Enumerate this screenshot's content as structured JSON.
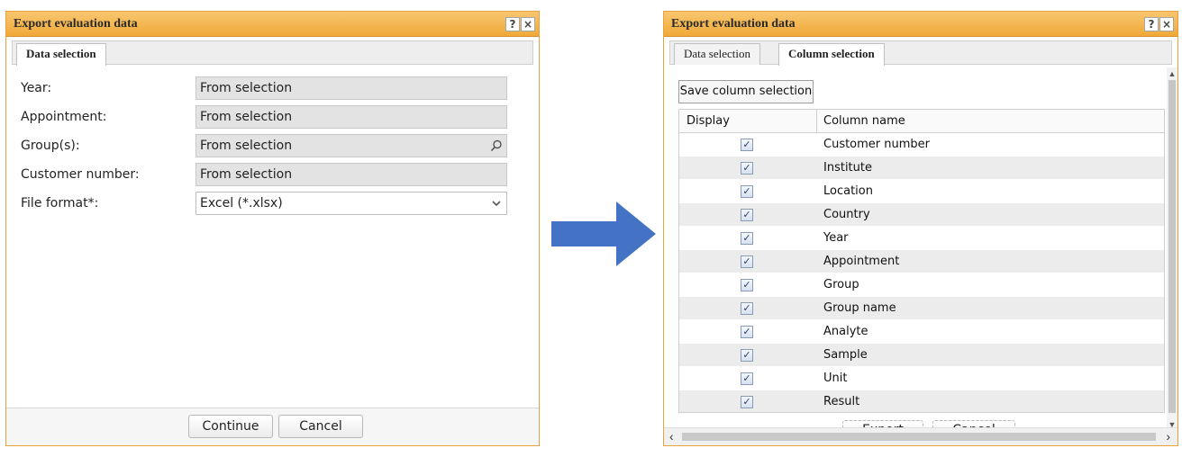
{
  "left_dialog": {
    "title": "Export evaluation data",
    "help_glyph": "?",
    "close_glyph": "×",
    "tabs": [
      {
        "label": "Data selection",
        "active": true
      }
    ],
    "fields": [
      {
        "label": "Year:",
        "value": "From selection"
      },
      {
        "label": "Appointment:",
        "value": "From selection"
      },
      {
        "label": "Group(s):",
        "value": "From selection",
        "icon": "search-icon"
      },
      {
        "label": "Customer number:",
        "value": "From selection"
      },
      {
        "label": "File format*:",
        "value": "Excel (*.xlsx)",
        "icon": "chevron-down-icon"
      }
    ],
    "continue_label": "Continue",
    "cancel_label": "Cancel"
  },
  "right_dialog": {
    "title": "Export evaluation data",
    "help_glyph": "?",
    "close_glyph": "×",
    "tabs": [
      {
        "label": "Data selection",
        "active": false
      },
      {
        "label": "Column selection",
        "active": true
      }
    ],
    "save_label": "Save column selection",
    "grid": {
      "headers": [
        "Display",
        "Column name"
      ],
      "rows": [
        {
          "checked": true,
          "name": "Customer number"
        },
        {
          "checked": true,
          "name": "Institute"
        },
        {
          "checked": true,
          "name": "Location"
        },
        {
          "checked": true,
          "name": "Country"
        },
        {
          "checked": true,
          "name": "Year"
        },
        {
          "checked": true,
          "name": "Appointment"
        },
        {
          "checked": true,
          "name": "Group"
        },
        {
          "checked": true,
          "name": "Group name"
        },
        {
          "checked": true,
          "name": "Analyte"
        },
        {
          "checked": true,
          "name": "Sample"
        },
        {
          "checked": true,
          "name": "Unit"
        },
        {
          "checked": true,
          "name": "Result"
        }
      ]
    },
    "export_label": "Export",
    "cancel_label": "Cancel"
  },
  "colors": {
    "titlebar": "#f0a938",
    "dialog_border": "#e9a23b",
    "arrow": "#4472c4",
    "row_alt": "#ececec"
  }
}
